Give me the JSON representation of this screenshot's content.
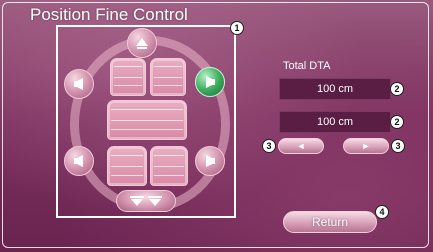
{
  "screen": {
    "title": "Position Fine Control"
  },
  "distance": {
    "label": "Total DTA",
    "value_1": "100 cm",
    "value_2": "100 cm"
  },
  "buttons": {
    "return_label": "Return",
    "left_arrow": "◄",
    "right_arrow": "►"
  },
  "callouts": {
    "c1": "1",
    "c2": "2",
    "c3": "3",
    "c4": "4"
  },
  "icons": {
    "speaker_front": "front-speaker-icon",
    "speaker_rear": "rear-speaker-icon",
    "move_up": "triangle-up-icon",
    "move_down": "double-triangle-down-icon"
  },
  "colors": {
    "background": "#7a2f5c",
    "field_bg": "#5a1e44",
    "active_speaker": "#3dae5f"
  }
}
